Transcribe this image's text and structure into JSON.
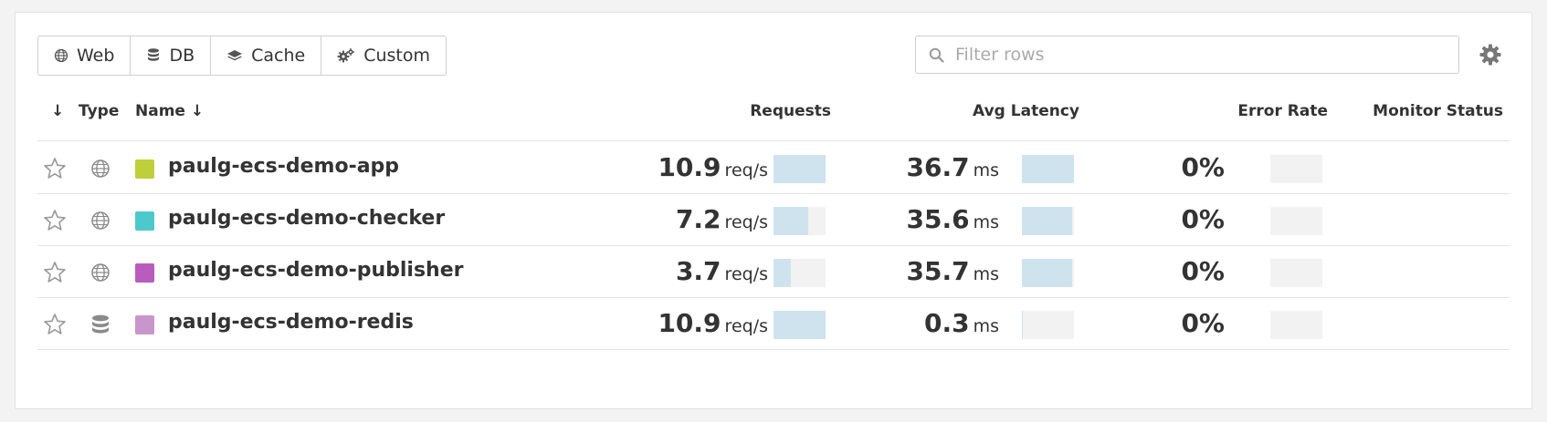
{
  "filters": [
    {
      "label": "Web",
      "icon": "globe-icon"
    },
    {
      "label": "DB",
      "icon": "database-icon"
    },
    {
      "label": "Cache",
      "icon": "layers-icon"
    },
    {
      "label": "Custom",
      "icon": "gears-icon"
    }
  ],
  "search": {
    "placeholder": "Filter rows",
    "value": ""
  },
  "columns": {
    "sort": "↓",
    "type": "Type",
    "name": "Name ↓",
    "requests": "Requests",
    "latency": "Avg Latency",
    "error_rate": "Error Rate",
    "monitor_status": "Monitor Status"
  },
  "colors": {
    "bar_fill": "#cfe3ee",
    "bar_track": "#f2f2f2"
  },
  "rows": [
    {
      "name": "paulg-ecs-demo-app",
      "type": "globe-icon",
      "color": "#bfcf3b",
      "requests": "10.9",
      "requests_unit": "req/s",
      "requests_fraction": 1.0,
      "latency": "36.7",
      "latency_unit": "ms",
      "latency_fraction": 1.0,
      "error_rate": "0%",
      "error_fraction": 0
    },
    {
      "name": "paulg-ecs-demo-checker",
      "type": "globe-icon",
      "color": "#4ec9cb",
      "requests": "7.2",
      "requests_unit": "req/s",
      "requests_fraction": 0.66,
      "latency": "35.6",
      "latency_unit": "ms",
      "latency_fraction": 0.97,
      "error_rate": "0%",
      "error_fraction": 0
    },
    {
      "name": "paulg-ecs-demo-publisher",
      "type": "globe-icon",
      "color": "#b95cbd",
      "requests": "3.7",
      "requests_unit": "req/s",
      "requests_fraction": 0.34,
      "latency": "35.7",
      "latency_unit": "ms",
      "latency_fraction": 0.97,
      "error_rate": "0%",
      "error_fraction": 0
    },
    {
      "name": "paulg-ecs-demo-redis",
      "type": "database-icon",
      "color": "#c996cc",
      "requests": "10.9",
      "requests_unit": "req/s",
      "requests_fraction": 1.0,
      "latency": "0.3",
      "latency_unit": "ms",
      "latency_fraction": 0.01,
      "error_rate": "0%",
      "error_fraction": 0
    }
  ]
}
